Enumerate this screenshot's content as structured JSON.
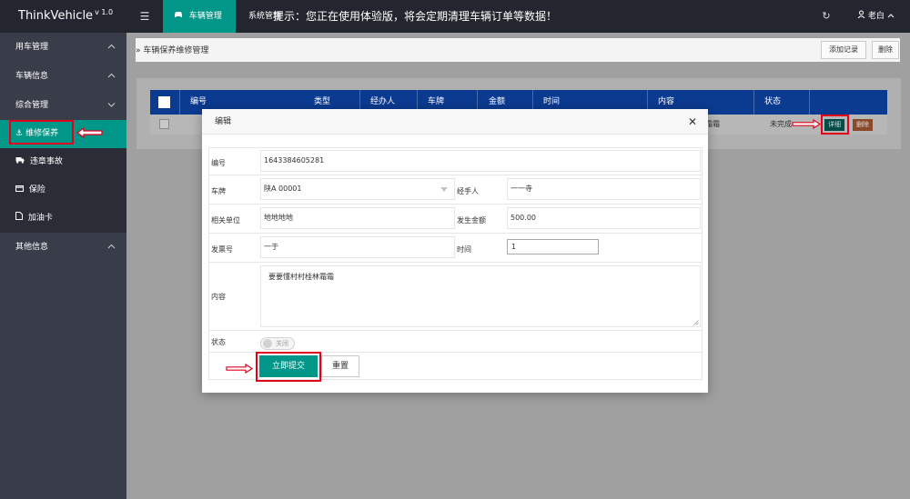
{
  "app": {
    "title": "ThinkVehicle",
    "version": "v 1.0",
    "menu_icon": "☰",
    "active_tab": "车辆管理",
    "tab2": "系统管理",
    "notice": "提示：您正在使用体验版，将会定期清理车辆订单等数据！",
    "refresh_icon": "↻",
    "user": "老白"
  },
  "sidebar": {
    "groups": [
      {
        "label": "用车管理",
        "expanded": false
      },
      {
        "label": "车辆信息",
        "expanded": false
      },
      {
        "label": "综合管理",
        "expanded": true
      },
      {
        "label": "其他信息",
        "expanded": false
      }
    ],
    "sub_items": [
      {
        "label": "维修保养",
        "icon": "anchor-icon",
        "active": true
      },
      {
        "label": "违章事故",
        "icon": "truck-icon",
        "active": false
      },
      {
        "label": "保险",
        "icon": "card-icon",
        "active": false
      },
      {
        "label": "加油卡",
        "icon": "file-icon",
        "active": false
      }
    ]
  },
  "page": {
    "breadcrumb": "车辆保养维修管理",
    "add_button": "添加记录",
    "delete_button": "删除"
  },
  "table": {
    "headers": [
      "编号",
      "类型",
      "经办人",
      "车牌",
      "金额",
      "时间",
      "内容",
      "状态"
    ],
    "row": {
      "content_partial": "霜霜",
      "status_partial": "未完成",
      "detail_button": "详细",
      "delete_button": "删除"
    }
  },
  "modal": {
    "title": "编辑",
    "close_icon": "✕",
    "fields": {
      "id_label": "编号",
      "id_value": "1643384605281",
      "plate_label": "车牌",
      "plate_value": "陕A 00001",
      "handler_label": "经手人",
      "handler_value": "一一寺",
      "unit_label": "相关单位",
      "unit_value": "地地地地",
      "amount_label": "发生金额",
      "amount_value": "500.00",
      "invoice_label": "发票号",
      "invoice_value": "一于",
      "time_label": "时间",
      "time_value": "1",
      "content_label": "内容",
      "content_value": "要要懂村村桂林霜霜",
      "status_label": "状态",
      "status_switch": "关闭"
    },
    "submit_button": "立即提交",
    "reset_button": "重置"
  },
  "colors": {
    "topbar": "#23262e",
    "sidebar": "#393d49",
    "accent": "#009688",
    "highlight": "#e3001b"
  }
}
